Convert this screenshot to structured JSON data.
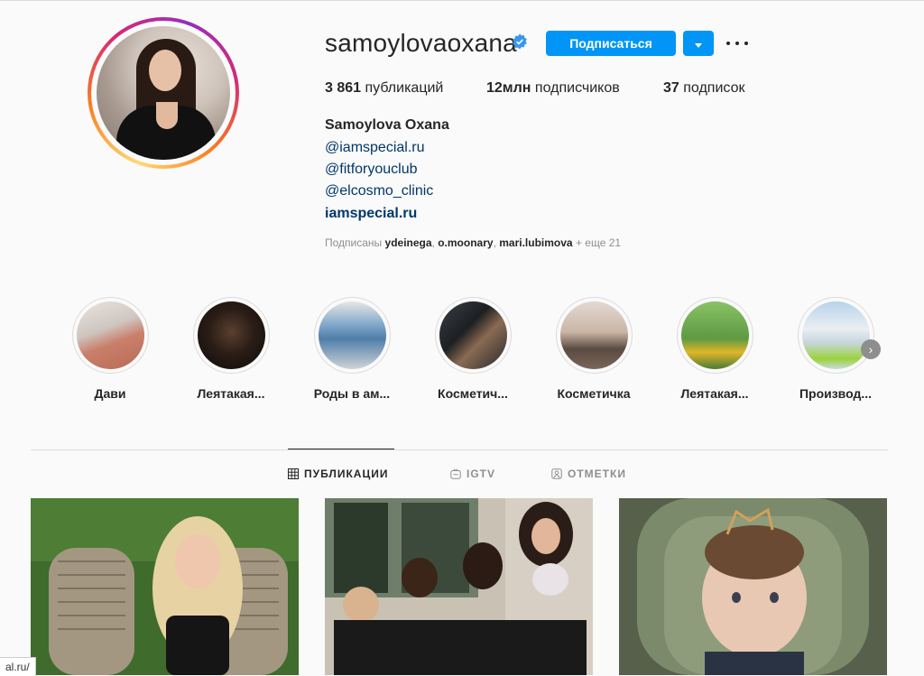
{
  "profile": {
    "username": "samoylovaoxana",
    "follow_label": "Подписаться",
    "stats": {
      "posts_count": "3 861",
      "posts_label": "публикаций",
      "followers_count": "12млн",
      "followers_label": "подписчиков",
      "following_count": "37",
      "following_label": "подписок"
    },
    "full_name": "Samoylova Oxana",
    "bio_links": [
      "@iamspecial.ru",
      "@fitforyouclub",
      "@elcosmo_clinic"
    ],
    "website": "iamspecial.ru",
    "followed_by": {
      "prefix": "Подписаны",
      "user1": "ydeinega",
      "user2": "o.moonary",
      "user3": "mari.lubimova",
      "suffix": "+ еще 21"
    }
  },
  "highlights": [
    {
      "label": "Дави"
    },
    {
      "label": "Леятакая..."
    },
    {
      "label": "Роды в ам..."
    },
    {
      "label": "Косметич..."
    },
    {
      "label": "Косметичка"
    },
    {
      "label": "Леятакая..."
    },
    {
      "label": "Производ..."
    }
  ],
  "tabs": [
    {
      "label": "ПУБЛИКАЦИИ",
      "icon": "grid-icon"
    },
    {
      "label": "IGTV",
      "icon": "igtv-icon"
    },
    {
      "label": "ОТМЕТКИ",
      "icon": "tagged-icon"
    }
  ],
  "status_bar": {
    "url": "al.ru/"
  },
  "colors": {
    "accent": "#0095f6",
    "link": "#00376b",
    "muted": "#8e8e8e",
    "text": "#262626"
  }
}
